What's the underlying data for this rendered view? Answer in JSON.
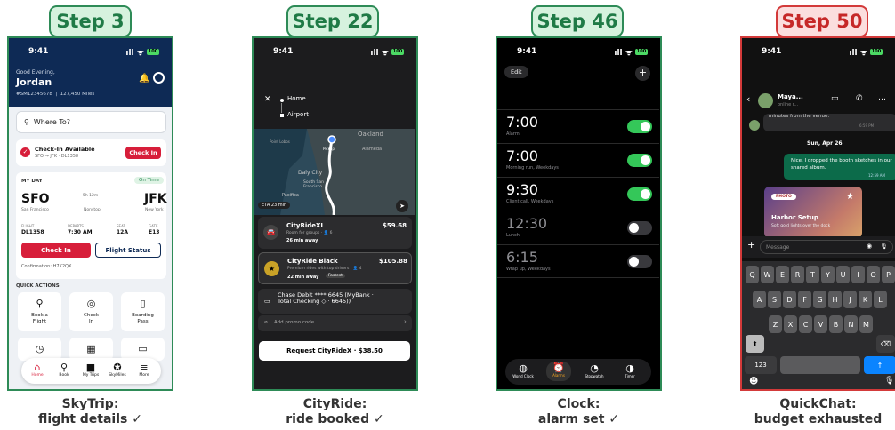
{
  "steps": [
    {
      "label": "Step 3",
      "caption1": "SkyTrip:",
      "caption2": "flight details ✓"
    },
    {
      "label": "Step 22",
      "caption1": "CityRide:",
      "caption2": "ride booked ✓"
    },
    {
      "label": "Step 46",
      "caption1": "Clock:",
      "caption2": "alarm set ✓"
    },
    {
      "label": "Step 50",
      "caption1": "QuickChat:",
      "caption2": "budget exhausted"
    }
  ],
  "time": "9:41",
  "p1": {
    "greeting": "Good Evening,",
    "name": "Jordan",
    "member": "#SM12345678  |  127,450 Miles",
    "search": "Where To?",
    "checkin_title": "Check-In Available",
    "checkin_sub": "SFO → JFK · DL1358",
    "checkin_btn": "Check In",
    "myday": "MY DAY",
    "ontime": "On Time",
    "from": "SFO",
    "from_city": "San Francisco",
    "dur": "5h 12m",
    "nonstop": "Nonstop",
    "to": "JFK",
    "to_city": "New York",
    "flight_l": "FLIGHT",
    "flight_v": "DL1358",
    "dep_l": "DEPARTS",
    "dep_v": "7:30 AM",
    "seat_l": "SEAT",
    "seat_v": "12A",
    "gate_l": "GATE",
    "gate_v": "E13",
    "btn_checkin": "Check In",
    "btn_status": "Flight Status",
    "conf": "Confirmation: H7K2QX",
    "qa_title": "QUICK ACTIONS",
    "qa": [
      "Book a\nFlight",
      "Check\nIn",
      "Boarding\nPass"
    ],
    "tabs": [
      "Home",
      "Book",
      "My Trips",
      "SkyMiles",
      "More"
    ]
  },
  "p2": {
    "loc1": "Home",
    "loc2": "Airport",
    "map_labels": [
      "Oakland",
      "Alameda",
      "Daly City",
      "South San\nFrancisco",
      "Pacifica",
      "Point Lobos"
    ],
    "eta": "ETA 23 min",
    "pickup": "Pickup",
    "r1_name": "CityRideXL",
    "r1_price": "$59.68",
    "r1_sub": "Room for groups · 👤 6",
    "r1_away": "26 min away",
    "r2_name": "CityRide Black",
    "r2_price": "$105.88",
    "r2_sub": "Premium rides with top drivers · 👤 4",
    "r2_away": "22 min away",
    "r2_badge": "Fastest",
    "pay": "Chase Debit **** 6645 (MyBank · Total Checking ◇ · 6645))",
    "promo": "Add promo code",
    "request": "Request CityRideX · $38.50"
  },
  "p3": {
    "edit": "Edit",
    "alarms": [
      {
        "t": "7:00",
        "l": "Alarm",
        "on": true
      },
      {
        "t": "7:00",
        "l": "Morning run, Weekdays",
        "on": true
      },
      {
        "t": "9:30",
        "l": "Client call, Weekdays",
        "on": true
      },
      {
        "t": "12:30",
        "l": "Lunch",
        "on": false
      },
      {
        "t": "6:15",
        "l": "Wrap up, Weekdays",
        "on": false
      }
    ],
    "tabs": [
      "World Clock",
      "Alarms",
      "Stopwatch",
      "Timer"
    ]
  },
  "p4": {
    "contact": "Maya...",
    "status": "online r...",
    "old": "minutes from the venue.",
    "old_time": "6:59 PM",
    "date": "Sun, Apr 26",
    "msg": "Nice. I dropped the booth sketches in our shared album.",
    "msg_time": "12:59 AM",
    "photo_tag": "PHOTO",
    "card_title": "Harbor Setup",
    "card_sub": "Soft gold lights over the dock",
    "placeholder": "Message",
    "row1": [
      "Q",
      "W",
      "E",
      "R",
      "T",
      "Y",
      "U",
      "I",
      "O",
      "P"
    ],
    "row2": [
      "A",
      "S",
      "D",
      "F",
      "G",
      "H",
      "J",
      "K",
      "L"
    ],
    "row3": [
      "Z",
      "X",
      "C",
      "V",
      "B",
      "N",
      "M"
    ],
    "num": "123"
  },
  "colors": {
    "green": "#2e8b57",
    "red": "#d33a3a",
    "navy": "#0e2a55",
    "skyred": "#d71e3a",
    "ios_green": "#34c759",
    "alarm_orange": "#f5a623",
    "chat_green": "#0c6b4a"
  }
}
